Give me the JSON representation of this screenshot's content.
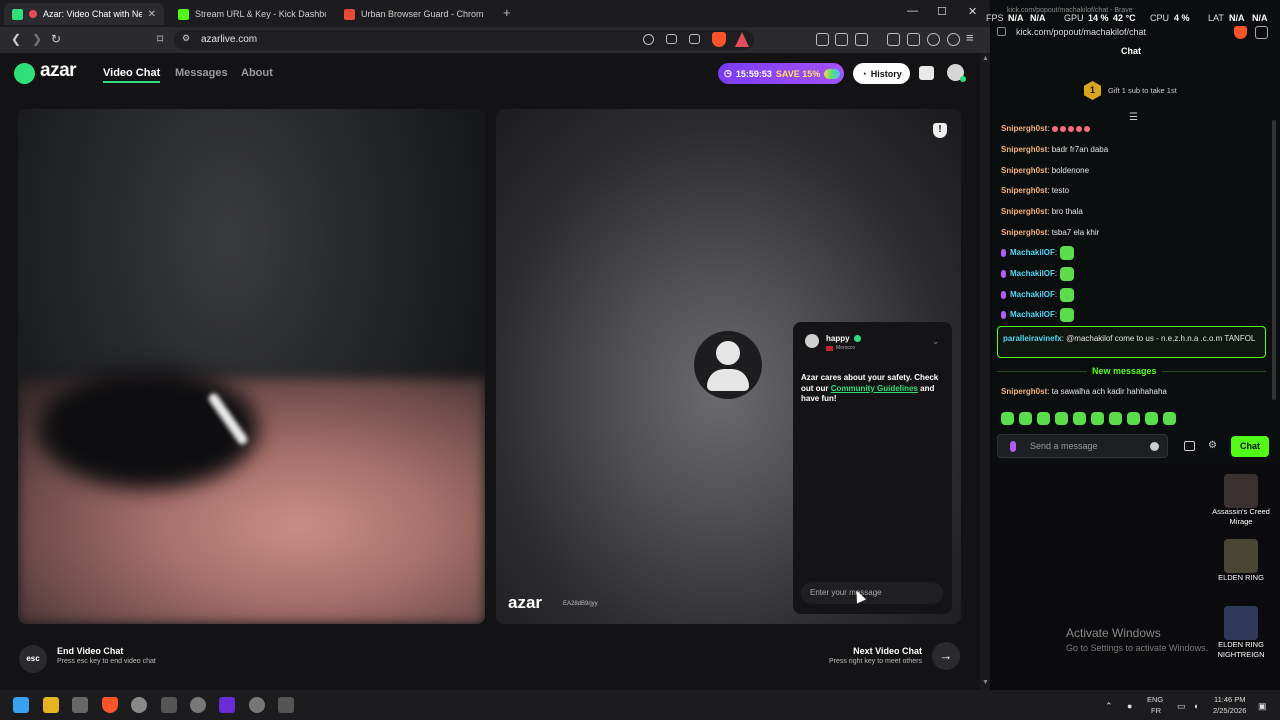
{
  "browser": {
    "tabs": [
      {
        "label": "Azar: Video Chat with New Pe",
        "active": true
      },
      {
        "label": "Stream URL & Key - Kick Dashboard",
        "active": false
      },
      {
        "label": "Urban Browser Guard - Chrome Web",
        "active": false
      }
    ],
    "new_tab": "+",
    "url": "azarlive.com",
    "window_controls": {
      "minimize": "—",
      "maximize": "☐",
      "close": "✕"
    }
  },
  "azar": {
    "logo": "azar",
    "nav": [
      "Video Chat",
      "Messages",
      "About"
    ],
    "timer": "15:59:53",
    "save": "SAVE 15%",
    "history": "History",
    "peer": {
      "name": "happy",
      "country": "Morocco",
      "watermark": "azar",
      "watermark_id": "EA28dB9rjyy"
    },
    "safety": {
      "prefix": "Azar cares about your safety. Check out our ",
      "link": "Community Guidelines",
      "suffix": " and have fun!"
    },
    "chat_placeholder": "Enter your message",
    "end": {
      "key": "esc",
      "title": "End Video Chat",
      "sub": "Press esc key to end video chat"
    },
    "next": {
      "title": "Next Video Chat",
      "sub": "Press right key to meet others",
      "arrow": "→"
    }
  },
  "kick": {
    "window_title": "kick.com/popout/machakilof/chat - Brave",
    "url": "kick.com/popout/machakilof/chat",
    "header": "Chat",
    "gift": {
      "rank": "1",
      "text": "Gift 1 sub to take 1st"
    },
    "messages": [
      {
        "user": "Snipergh0st",
        "text": "",
        "color": "#f3b27a",
        "emotes_sm": 5
      },
      {
        "user": "Snipergh0st",
        "text": "badr fr7an daba",
        "color": "#f3b27a"
      },
      {
        "user": "Snipergh0st",
        "text": "boldenone",
        "color": "#f3b27a"
      },
      {
        "user": "Snipergh0st",
        "text": "testo",
        "color": "#f3b27a"
      },
      {
        "user": "Snipergh0st",
        "text": "bro thala",
        "color": "#f3b27a"
      },
      {
        "user": "Snipergh0st",
        "text": "tsba7 ela khir",
        "color": "#f3b27a"
      },
      {
        "user": "MachakilOF",
        "text": "",
        "color": "#53d6f5",
        "mic": true,
        "emote": true
      },
      {
        "user": "MachakilOF",
        "text": "",
        "color": "#53d6f5",
        "mic": true,
        "emote": true
      },
      {
        "user": "MachakilOF",
        "text": "",
        "color": "#53d6f5",
        "mic": true,
        "emote": true
      },
      {
        "user": "MachakilOF",
        "text": "",
        "color": "#53d6f5",
        "mic": true,
        "emote": true
      }
    ],
    "mention": {
      "user": "paralleiravinefx",
      "text": "@machakilof come to us - n.e.z.h.n.a .c.o.m TANFOL"
    },
    "new_messages": "New messages",
    "after": {
      "user": "Snipergh0st",
      "text": "ta sawalha ach kadir hahhahaha"
    },
    "input_placeholder": "Send a message",
    "chat_button": "Chat"
  },
  "osd": {
    "fps_label": "FPS",
    "fps": "N/A",
    "fps2": "N/A",
    "gpu_label": "GPU",
    "gpu": "14 %",
    "gpu_temp": "42 °C",
    "cpu_label": "CPU",
    "cpu": "4 %",
    "lat_label": "LAT",
    "lat": "N/A",
    "lat2": "N/A"
  },
  "desktop": {
    "icons": [
      {
        "label": "Assassin's Creed Mirage",
        "color": "#3a3230"
      },
      {
        "label": "ELDEN RING",
        "color": "#4a4636"
      },
      {
        "label": "ELDEN RING NIGHTREIGN",
        "color": "#2f3a5a"
      }
    ],
    "activate_title": "Activate Windows",
    "activate_sub": "Go to Settings to activate Windows."
  },
  "taskbar": {
    "lang1": "ENG",
    "lang2": "FR",
    "time": "11:46 PM",
    "date": "2/25/2026"
  }
}
